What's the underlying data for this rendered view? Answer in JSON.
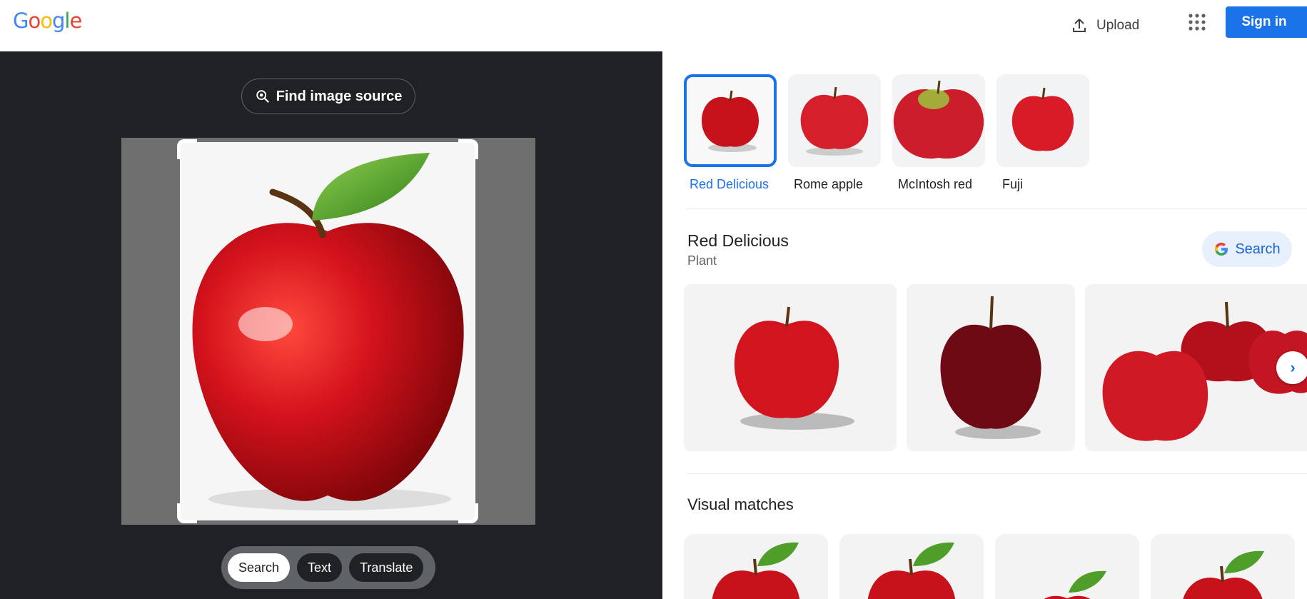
{
  "header": {
    "logo_letters": [
      {
        "ch": "G",
        "color": "#4285F4"
      },
      {
        "ch": "o",
        "color": "#EA4335"
      },
      {
        "ch": "o",
        "color": "#FBBC05"
      },
      {
        "ch": "g",
        "color": "#4285F4"
      },
      {
        "ch": "l",
        "color": "#34A853"
      },
      {
        "ch": "e",
        "color": "#EA4335"
      }
    ],
    "upload_label": "Upload",
    "apps_icon": "apps-grid-icon",
    "signin_label": "Sign in"
  },
  "left": {
    "find_source_label": "Find image source",
    "modes": [
      {
        "label": "Search",
        "active": true
      },
      {
        "label": "Text",
        "active": false
      },
      {
        "label": "Translate",
        "active": false
      }
    ]
  },
  "right": {
    "chips": [
      {
        "label": "Red Delicious",
        "selected": true
      },
      {
        "label": "Rome apple",
        "selected": false
      },
      {
        "label": "McIntosh red",
        "selected": false
      },
      {
        "label": "Fuji",
        "selected": false
      }
    ],
    "entity": {
      "title": "Red Delicious",
      "subtitle": "Plant",
      "search_label": "Search"
    },
    "visual_matches_title": "Visual matches"
  },
  "colors": {
    "accent": "#1a73e8",
    "dark_panel": "#202124",
    "apple_red": "#c8121b"
  }
}
